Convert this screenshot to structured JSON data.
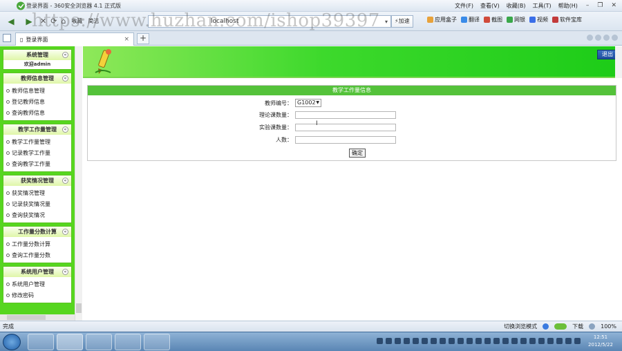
{
  "browser": {
    "window_title": "登录界面 - 360安全浏览器 4.1 正式版",
    "menu": [
      "文件(F)",
      "查看(V)",
      "收藏(B)",
      "工具(T)",
      "帮助(H)"
    ],
    "window_controls": [
      "–",
      "❐",
      "✕"
    ],
    "nav": {
      "back": "◀",
      "forward": "▶",
      "close": "✕",
      "refresh": "⟳",
      "home": "⌂",
      "favorites_label": "收藏",
      "other_label": "简洁"
    },
    "address": "localhost",
    "accelerate_label": "⚡加速",
    "tools": [
      "应用盒子",
      "翻译",
      "截图",
      "网银",
      "视频",
      "软件宝库"
    ],
    "tab_title": "登录界面",
    "tab_close": "×",
    "new_tab": "+",
    "status_text": "完成",
    "status_right": [
      "切换浏览模式",
      "下载",
      "100%"
    ],
    "clock_time": "12:51",
    "clock_date": "2012/5/22"
  },
  "watermark": "https://www.huzhan.com/ishop39397",
  "sidebar": {
    "groups": [
      {
        "title": "系统管理",
        "welcome": "欢迎admin",
        "items": []
      },
      {
        "title": "教师信息管理",
        "items": [
          "教师信息管理",
          "登记教师信息",
          "查询教师信息"
        ]
      },
      {
        "title": "教学工作量管理",
        "items": [
          "教学工作量管理",
          "记录教学工作量",
          "查询教学工作量"
        ]
      },
      {
        "title": "获奖情况管理",
        "items": [
          "获奖情况管理",
          "记录获奖情况量",
          "查询获奖情况"
        ]
      },
      {
        "title": "工作量分数计算",
        "items": [
          "工作量分数计算",
          "查询工作量分数"
        ]
      },
      {
        "title": "系统用户管理",
        "items": [
          "系统用户管理",
          "修改密码"
        ]
      }
    ],
    "collapse_glyph": "«"
  },
  "header": {
    "logout_label": "退出"
  },
  "form": {
    "title": "教学工作量信息",
    "teacher_id_label": "教师编号：",
    "teacher_id_value": "G1002",
    "theory_label": "理论课数量：",
    "lab_label": "实验课数量：",
    "people_label": "人数：",
    "submit_label": "确定"
  },
  "colors": {
    "accent_green": "#54c23a",
    "sidebar_green": "#56d61f",
    "logout_blue": "#1d4d9c"
  }
}
